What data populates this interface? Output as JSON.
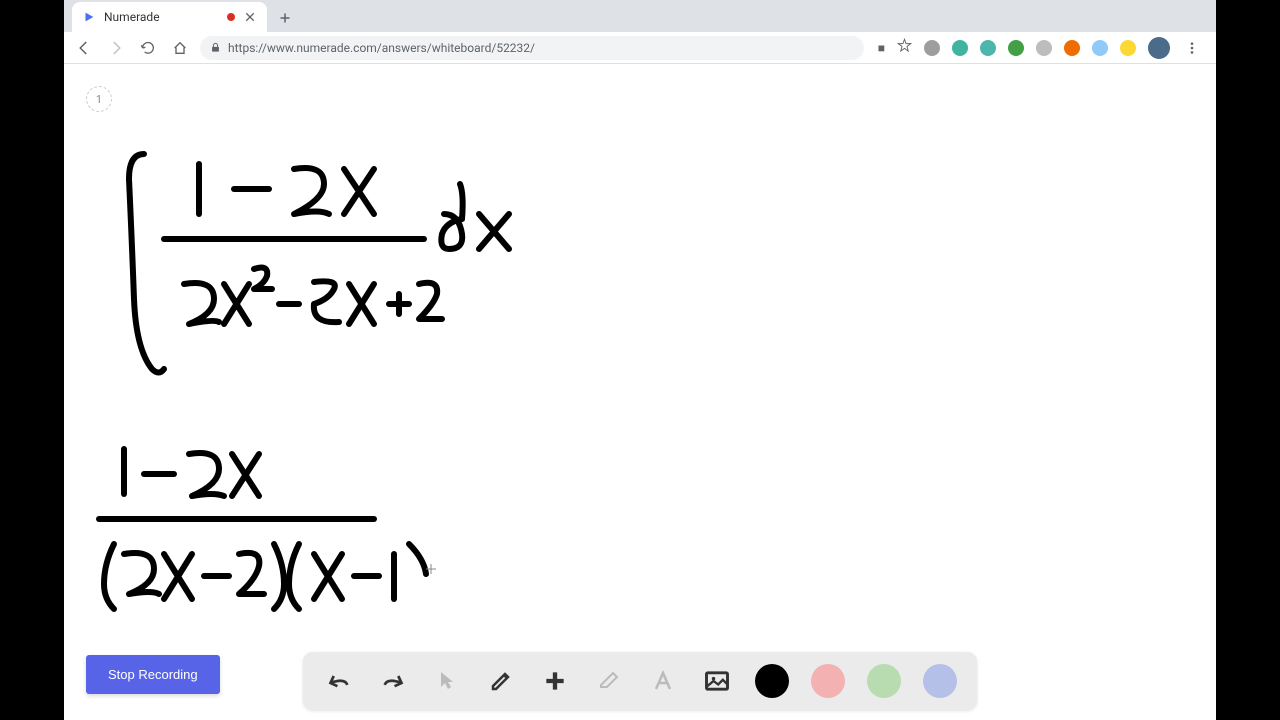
{
  "browser": {
    "tab_title": "Numerade",
    "url": "https://www.numerade.com/answers/whiteboard/52232/"
  },
  "page": {
    "indicator": "1",
    "stop_button": "Stop Recording"
  },
  "toolbar": {
    "colors": {
      "black": "#000000",
      "red": "#f3b1b1",
      "green": "#b8dcb0",
      "blue": "#b4c0e8"
    }
  },
  "extensions": {
    "e1": "#9e9e9e",
    "e2": "#3fb5a0",
    "e3": "#4db6ac",
    "e4": "#43a047",
    "e5": "#bdbdbd",
    "e6": "#ef6c00",
    "e7": "#90caf9",
    "e8": "#fdd835"
  }
}
